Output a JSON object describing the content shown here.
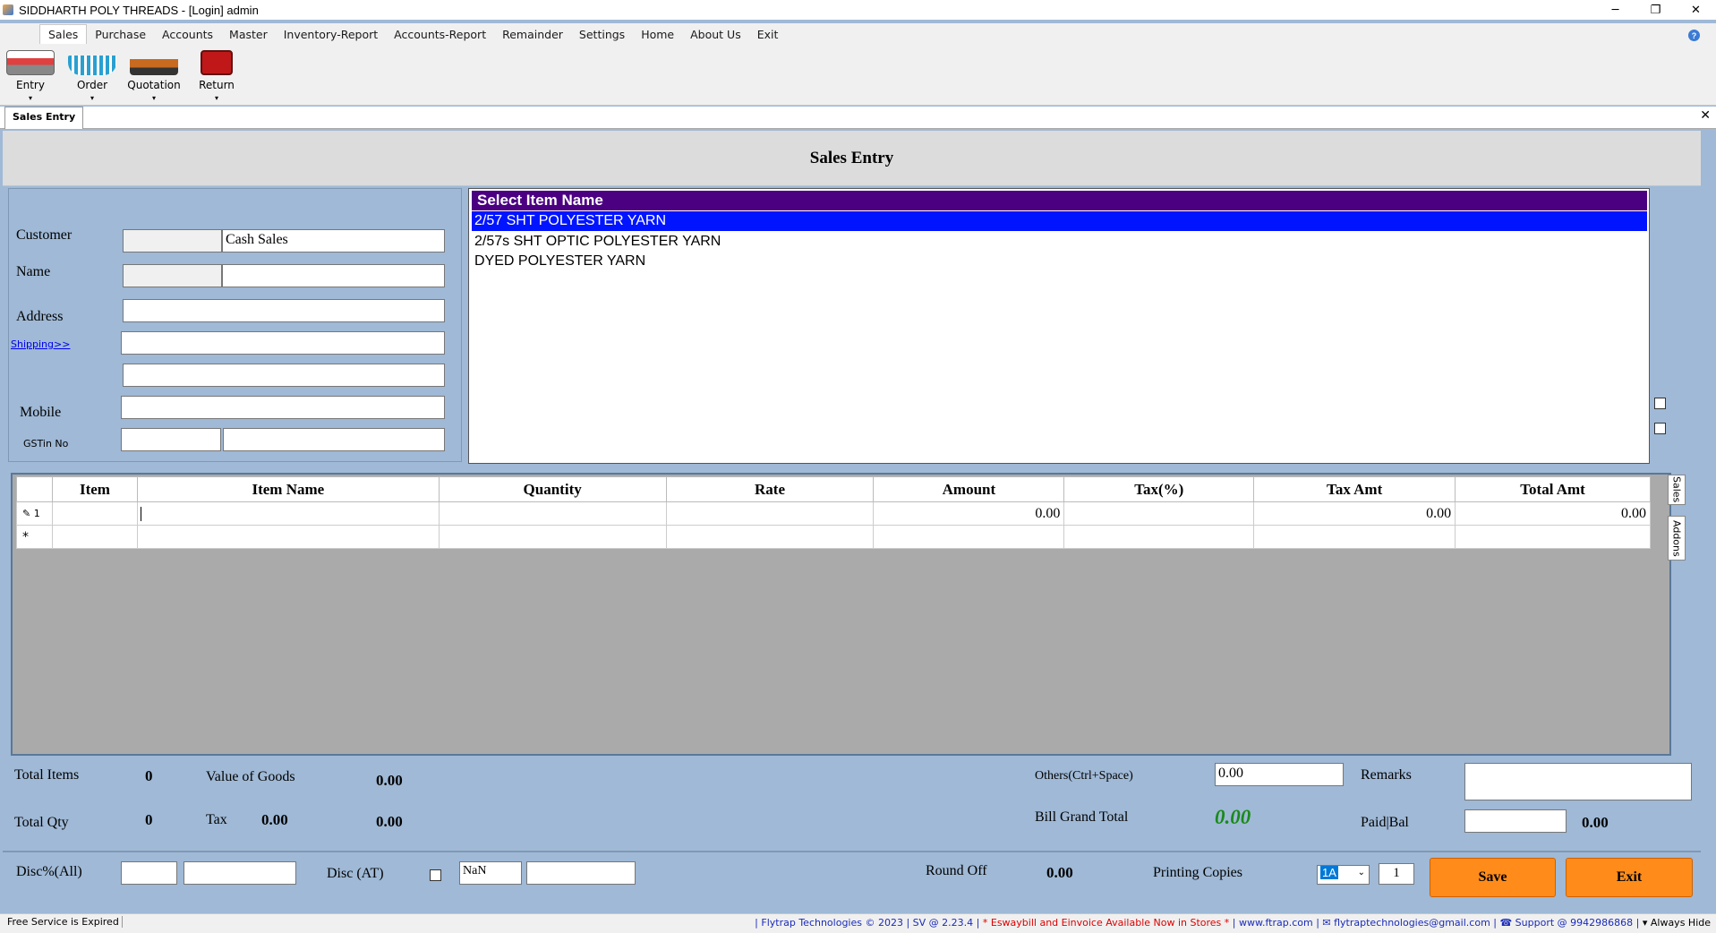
{
  "window": {
    "title": "SIDDHARTH POLY THREADS - [Login]  admin",
    "minimize": "─",
    "restore": "❐",
    "close": "✕"
  },
  "menu": {
    "items": [
      "Sales",
      "Purchase",
      "Accounts",
      "Master",
      "Inventory-Report",
      "Accounts-Report",
      "Remainder",
      "Settings",
      "Home",
      "About Us",
      "Exit"
    ],
    "help_icon": "?"
  },
  "ribbon": {
    "buttons": [
      {
        "label": "Entry",
        "icon": "register-icon",
        "dropdown": "▾"
      },
      {
        "label": "Order",
        "icon": "basket-icon",
        "dropdown": "▾"
      },
      {
        "label": "Quotation",
        "icon": "scale-icon",
        "dropdown": "▾"
      },
      {
        "label": "Return",
        "icon": "return-icon",
        "dropdown": "▾"
      }
    ]
  },
  "tabs": {
    "active": "Sales Entry",
    "close": "✕"
  },
  "form": {
    "title": "Sales Entry",
    "customer_label": "Customer",
    "customer_value": "Cash Sales",
    "name_label": "Name",
    "address_label": "Address",
    "shipping_link": "Shipping>>",
    "mobile_label": "Mobile",
    "gstin_label": "GSTin No"
  },
  "item_list": {
    "header": "Select Item Name",
    "items": [
      "2/57 SHT POLYESTER YARN",
      "2/57s SHT OPTIC  POLYESTER YARN",
      "DYED POLYESTER YARN"
    ],
    "selected_index": 0
  },
  "grid": {
    "columns": [
      "Item",
      "Item Name",
      "Quantity",
      "Rate",
      "Amount",
      "Tax(%)",
      "Tax Amt",
      "Total Amt"
    ],
    "rows": [
      {
        "marker": "✎ 1",
        "item": "",
        "item_name": "",
        "quantity": "",
        "rate": "",
        "amount": "0.00",
        "tax_pct": "",
        "tax_amt": "0.00",
        "total_amt": "0.00"
      }
    ],
    "new_row_marker": "*",
    "side_tabs": [
      "Sales",
      "Addons"
    ]
  },
  "summary": {
    "total_items_label": "Total Items",
    "total_items": "0",
    "value_goods_label": "Value of Goods",
    "value_goods": "0.00",
    "total_qty_label": "Total Qty",
    "total_qty": "0",
    "tax_label": "Tax",
    "tax_value": "0.00",
    "tax_total": "0.00",
    "others_label": "Others(Ctrl+Space)",
    "others_value": "0.00",
    "remarks_label": "Remarks",
    "grand_total_label": "Bill Grand Total",
    "grand_total": "0.00",
    "paid_bal_label": "Paid|Bal",
    "paid_bal_value": "0.00"
  },
  "footer": {
    "disc_all_label": "Disc%(All)",
    "disc_at_label": "Disc (AT)",
    "disc_at_value": "NaN",
    "round_off_label": "Round Off",
    "round_off_value": "0.00",
    "printing_copies_label": "Printing Copies",
    "copies_type": "1A",
    "copies_count": "1",
    "save": "Save",
    "exit": "Exit"
  },
  "status": {
    "left": "Free Service is Expired",
    "company": "| Flytrap Technologies © 2023 |  SV @ 2.23.4 |",
    "promo": "* Eswaybill and  Einvoice Available Now in Stores *",
    "links": "| www.ftrap.com | ✉ flytraptechnologies@gmail.com | ☎ Support @ 9942986868 |",
    "always_hide": "▾ Always Hide"
  },
  "colors": {
    "panel_bg": "#9fb9d6",
    "list_header": "#4b0082",
    "list_selected": "#0014ff",
    "button_orange": "#ff8c1a",
    "grand_total": "#1a8a1a"
  }
}
